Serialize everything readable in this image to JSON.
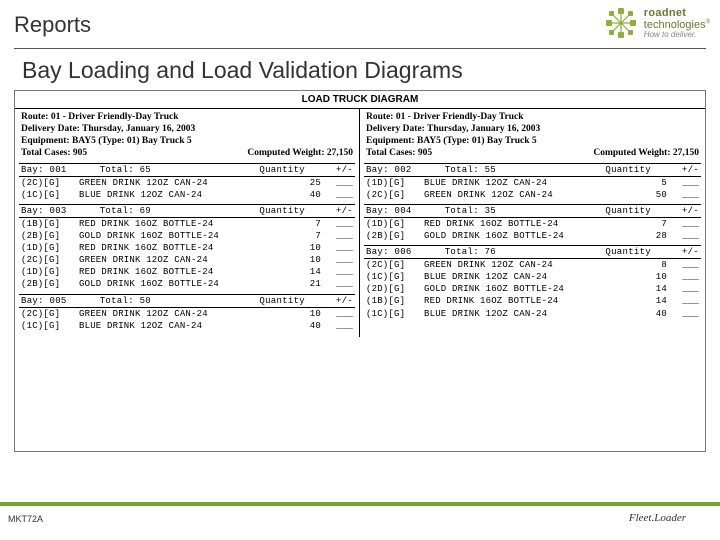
{
  "header": {
    "title": "Reports",
    "brand_main": "roadnet",
    "brand_sub": "technologies",
    "brand_tag": "How to deliver."
  },
  "subtitle": "Bay Loading and Load Validation Diagrams",
  "diagram": {
    "title": "LOAD TRUCK DIAGRAM",
    "meta": {
      "route": "Route: 01 - Driver Friendly-Day Truck",
      "delivery": "Delivery Date: Thursday, January 16, 2003",
      "equipment": "Equipment: BAY5 (Type: 01)  Bay Truck 5",
      "total_cases": "Total Cases: 905",
      "computed_weight": "Computed Weight: 27,150"
    }
  },
  "left_sections": [
    {
      "bay": "Bay: 001",
      "total": "Total:   65",
      "qlabel": "Quantity",
      "pm": "+/-",
      "rows": [
        {
          "code": "(2C)[G]",
          "desc": "GREEN DRINK 12OZ CAN-24",
          "qty": "25"
        },
        {
          "code": "(1C)[G]",
          "desc": "BLUE DRINK 12OZ CAN-24",
          "qty": "40"
        }
      ]
    },
    {
      "bay": "Bay: 003",
      "total": "Total:   69",
      "qlabel": "Quantity",
      "pm": "+/-",
      "rows": [
        {
          "code": "(1B)[G]",
          "desc": "RED DRINK 16OZ BOTTLE-24",
          "qty": "7"
        },
        {
          "code": "(2B)[G]",
          "desc": "GOLD DRINK 16OZ BOTTLE-24",
          "qty": "7"
        },
        {
          "code": "(1D)[G]",
          "desc": "RED DRINK 16OZ BOTTLE-24",
          "qty": "10"
        },
        {
          "code": "(2C)[G]",
          "desc": "GREEN DRINK 12OZ CAN-24",
          "qty": "10"
        },
        {
          "code": "(1D)[G]",
          "desc": "RED DRINK 16OZ BOTTLE-24",
          "qty": "14"
        },
        {
          "code": "(2B)[G]",
          "desc": "GOLD DRINK 16OZ BOTTLE-24",
          "qty": "21"
        }
      ]
    },
    {
      "bay": "Bay: 005",
      "total": "Total:   50",
      "qlabel": "Quantity",
      "pm": "+/-",
      "rows": [
        {
          "code": "(2C)[G]",
          "desc": "GREEN DRINK 12OZ CAN-24",
          "qty": "10"
        },
        {
          "code": "(1C)[G]",
          "desc": "BLUE DRINK 12OZ CAN-24",
          "qty": "40"
        }
      ]
    }
  ],
  "right_sections": [
    {
      "bay": "Bay: 002",
      "total": "Total:   55",
      "qlabel": "Quantity",
      "pm": "+/-",
      "rows": [
        {
          "code": "(1D)[G]",
          "desc": "BLUE DRINK 12OZ CAN-24",
          "qty": "5"
        },
        {
          "code": "(2C)[G]",
          "desc": "GREEN DRINK 12OZ CAN-24",
          "qty": "50"
        }
      ]
    },
    {
      "bay": "Bay: 004",
      "total": "Total:   35",
      "qlabel": "Quantity",
      "pm": "+/-",
      "rows": [
        {
          "code": "(1D)[G]",
          "desc": "RED DRINK 16OZ BOTTLE-24",
          "qty": "7"
        },
        {
          "code": "(2B)[G]",
          "desc": "GOLD DRINK 16OZ BOTTLE-24",
          "qty": "28"
        }
      ]
    },
    {
      "bay": "Bay: 006",
      "total": "Total:   76",
      "qlabel": "Quantity",
      "pm": "+/-",
      "rows": [
        {
          "code": "(2C)[G]",
          "desc": "GREEN DRINK 12OZ CAN-24",
          "qty": "8"
        },
        {
          "code": "(1C)[G]",
          "desc": "BLUE DRINK 12OZ CAN-24",
          "qty": "10"
        },
        {
          "code": "(2D)[G]",
          "desc": "GOLD DRINK 16OZ BOTTLE-24",
          "qty": "14"
        },
        {
          "code": "(1B)[G]",
          "desc": "RED DRINK 16OZ BOTTLE-24",
          "qty": "14"
        },
        {
          "code": "(1C)[G]",
          "desc": "BLUE DRINK 12OZ CAN-24",
          "qty": "40"
        }
      ]
    }
  ],
  "footer": {
    "left": "MKT72A",
    "right": "Fleet.Loader"
  }
}
